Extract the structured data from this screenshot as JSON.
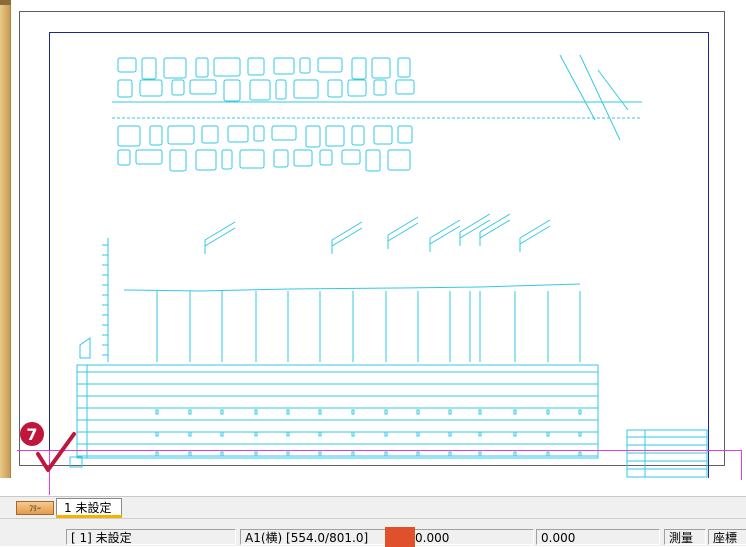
{
  "canvas": {
    "step_marker": "7",
    "colors": {
      "drawing_lines": "#33c8e6",
      "frame": "#1b2a8f",
      "guide": "#e040e0",
      "marker": "#c0163b",
      "check": "#c0163b"
    },
    "icons": [
      "check-icon"
    ]
  },
  "tabs": {
    "free_label": "ﾌﾘｰ",
    "layer_label": "1 未設定"
  },
  "status": {
    "layer": "[ 1] 未設定",
    "paper": "A1(横) [554.0/801.0]",
    "x": "0.000",
    "y": "0.000",
    "mode": "測量",
    "coord": "座標"
  }
}
